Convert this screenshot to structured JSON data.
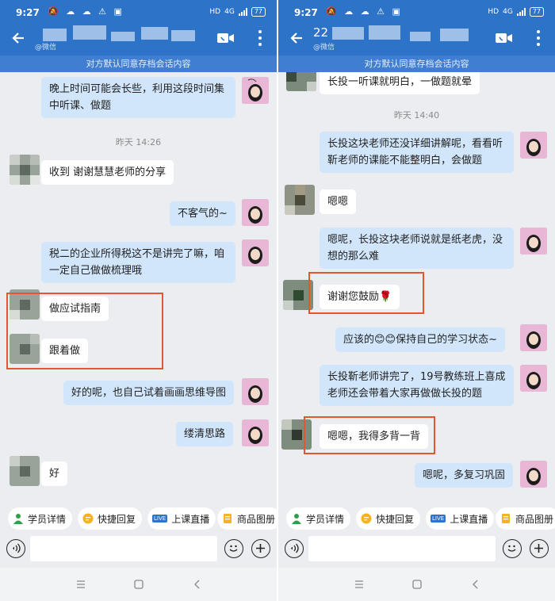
{
  "status": {
    "time": "9:27",
    "hd": "HD",
    "network": "4G",
    "battery": "77"
  },
  "left": {
    "header": {
      "name": "",
      "subname": "@微信"
    },
    "notice": "对方默认同意存档会话内容",
    "messages": [
      {
        "side": "out",
        "text": "晚上时间可能会长些，利用这段时间集中听课、做题"
      },
      {
        "side": "ts",
        "text": "昨天  14:26"
      },
      {
        "side": "in",
        "text": "收到 谢谢慧慧老师的分享"
      },
      {
        "side": "out",
        "text": "不客气的~"
      },
      {
        "side": "out",
        "text": "税二的企业所得税这不是讲完了嘛，咱一定自己做做梳理哦"
      },
      {
        "side": "in",
        "text": "做应试指南"
      },
      {
        "side": "in",
        "text": "跟着做"
      },
      {
        "side": "out",
        "text": "好的呢，也自己试着画画思维导图"
      },
      {
        "side": "out",
        "text": "缕清思路"
      },
      {
        "side": "in",
        "text": "好"
      }
    ]
  },
  "right": {
    "header": {
      "name": "22",
      "subname": "@微信"
    },
    "notice": "对方默认同意存档会话内容",
    "messages": [
      {
        "side": "in",
        "text": "长投一听课就明白，一做题就晕"
      },
      {
        "side": "ts",
        "text": "昨天  14:40"
      },
      {
        "side": "out",
        "text": "长投这块老师还没详细讲解呢，看看听靳老师的课能不能整明白，会做题"
      },
      {
        "side": "in",
        "text": "嗯嗯"
      },
      {
        "side": "out",
        "text": "嗯呢，长投这块老师说就是纸老虎，没想的那么难"
      },
      {
        "side": "in",
        "text": "谢谢您鼓励🌹"
      },
      {
        "side": "out",
        "text": "应该的😊😊保持自己的学习状态~"
      },
      {
        "side": "out",
        "text": "长投靳老师讲完了，19号教练班上喜成老师还会带着大家再做做长投的题"
      },
      {
        "side": "in",
        "text": "嗯嗯，我得多背一背"
      },
      {
        "side": "out",
        "text": "嗯呢，多复习巩固"
      }
    ]
  },
  "toolbar": {
    "student_info": "学员详情",
    "quick_reply": "快捷回复",
    "live": "上课直播",
    "live_badge": "LIVE",
    "product_album": "商品图册"
  },
  "colors": {
    "header": "#2d73c8",
    "out_bubble": "#d2e6fb",
    "highlight": "#e4572e"
  }
}
